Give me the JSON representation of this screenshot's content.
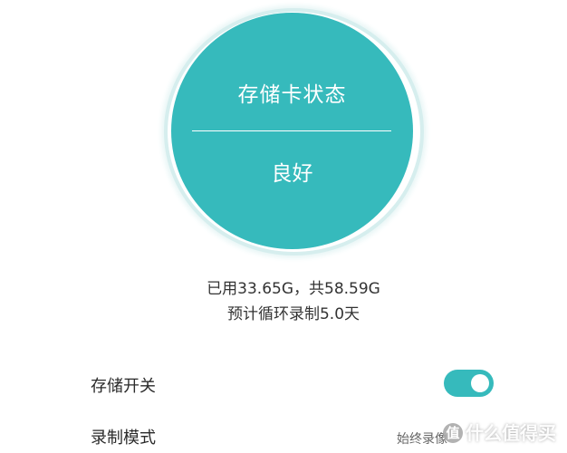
{
  "status_card": {
    "title": "存储卡状态",
    "value": "良好"
  },
  "usage": {
    "used_total": "已用33.65G，共58.59G",
    "estimate": "预计循环录制5.0天"
  },
  "settings": {
    "storage_switch": {
      "label": "存储开关",
      "on": true
    },
    "record_mode": {
      "label": "录制模式",
      "value": "始终录像"
    }
  },
  "watermark": {
    "badge": "值",
    "text": "什么值得买"
  },
  "colors": {
    "accent": "#36babc",
    "text_primary": "#2a2a2a",
    "text_secondary": "#666666"
  }
}
